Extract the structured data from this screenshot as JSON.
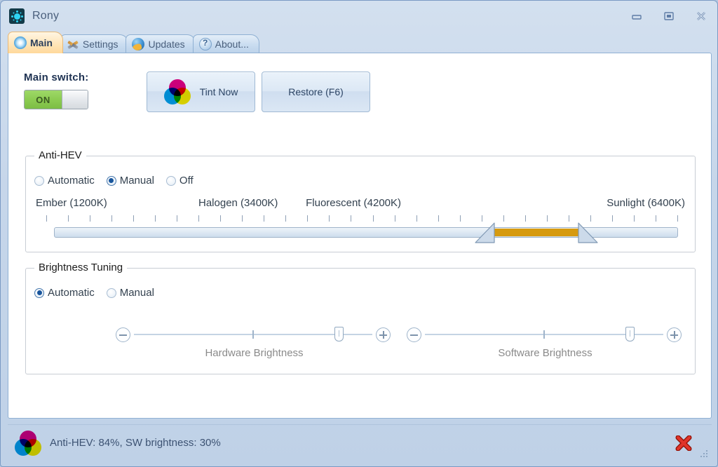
{
  "window": {
    "title": "Rony",
    "app_icon": "sun-burst-icon",
    "controls": {
      "minimize": "minimize-icon",
      "maximize": "maximize-icon",
      "close": "close-icon"
    }
  },
  "tabs": [
    {
      "label": "Main",
      "icon": "starburst-icon",
      "active": true
    },
    {
      "label": "Settings",
      "icon": "tools-icon",
      "active": false
    },
    {
      "label": "Updates",
      "icon": "globe-icon",
      "active": false
    },
    {
      "label": "About...",
      "icon": "help-icon",
      "active": false
    }
  ],
  "main": {
    "main_switch": {
      "label": "Main switch:",
      "state": "ON"
    },
    "buttons": {
      "tint_now": "Tint Now",
      "restore": "Restore (F6)"
    },
    "anti_hev": {
      "title": "Anti-HEV",
      "modes": [
        {
          "label": "Automatic",
          "selected": false
        },
        {
          "label": "Manual",
          "selected": true
        },
        {
          "label": "Off",
          "selected": false
        }
      ],
      "scale_labels": [
        {
          "text": "Ember (1200K)",
          "pos_pct": 0.0
        },
        {
          "text": "Halogen (3400K)",
          "pos_pct": 25.0
        },
        {
          "text": "Fluorescent (4200K)",
          "pos_pct": 41.5
        },
        {
          "text": "Sunlight (6400K)",
          "pos_pct": 100.0
        }
      ],
      "tick_count": 30,
      "range": {
        "low_pct": 70.5,
        "high_pct": 84.0,
        "fill_color": "#d69a10"
      }
    },
    "brightness_tuning": {
      "title": "Brightness Tuning",
      "modes": [
        {
          "label": "Automatic",
          "selected": true
        },
        {
          "label": "Manual",
          "selected": false
        }
      ],
      "sliders": [
        {
          "caption": "Hardware Brightness",
          "value_pct": 86.0,
          "minus": "minus-icon",
          "plus": "plus-icon"
        },
        {
          "caption": "Software Brightness",
          "value_pct": 86.0,
          "minus": "minus-icon",
          "plus": "plus-icon"
        }
      ]
    }
  },
  "statusbar": {
    "icon": "cmy-venn-icon",
    "text": "Anti-HEV: 84%, SW brightness: 30%",
    "close_icon": "red-x-icon",
    "grip": "resize-grip"
  },
  "colors": {
    "accent_orange": "#d69a10",
    "toggle_green": "#8ccc52",
    "frame_blue": "#bfd1e7",
    "text_dark": "#33414f",
    "close_red": "#d42b1e"
  }
}
